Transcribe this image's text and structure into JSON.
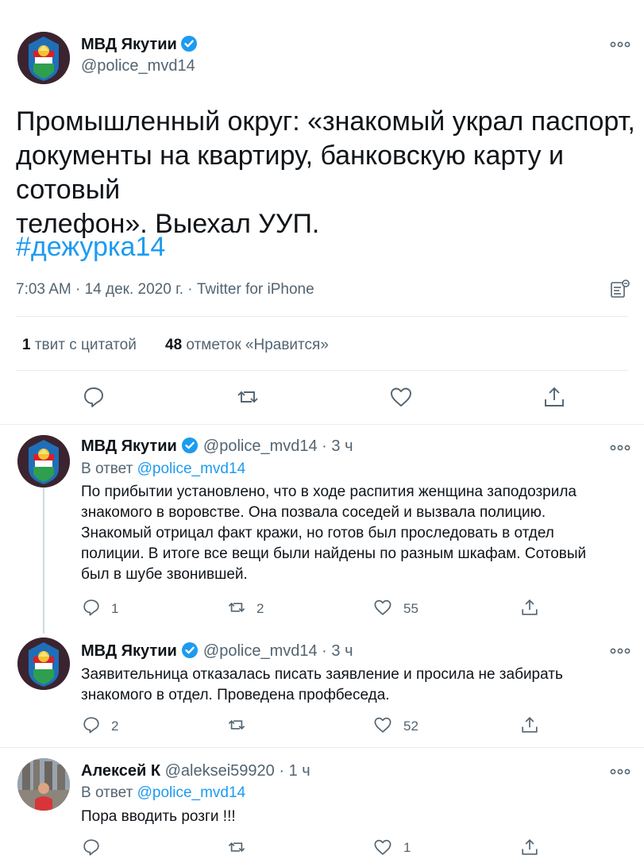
{
  "main_tweet": {
    "author_name": "МВД Якутии",
    "author_handle": "@police_mvd14",
    "text_lines": [
      "Промышленный округ: «знакомый украл паспорт,",
      "документы на квартиру, банковскую карту и сотовый",
      "телефон». Выехал УУП."
    ],
    "hashtag": "#дежурка14",
    "meta": "7:03 AM · 14 дек. 2020 г. · Twitter for iPhone",
    "quote_count": "1",
    "quote_label": "твит с цитатой",
    "like_count": "48",
    "like_label": "отметок «Нравится»"
  },
  "replies": [
    {
      "author_name": "МВД Якутии",
      "author_handle": "@police_mvd14 · 3 ч",
      "reply_to_prefix": "В ответ",
      "reply_to_mention": "@police_mvd14",
      "text_lines": [
        "По прибытии установлено, что в ходе распития женщина заподозрила",
        "знакомого в воровстве. Она позвала соседей и вызвала полицию.",
        "Знакомый отрицал факт кражи, но готов был проследовать в отдел",
        "полиции. В итоге все вещи были найдены по разным шкафам. Сотовый",
        "был в шубе звонившей."
      ],
      "reply_count": "1",
      "retweet_count": "2",
      "like_count": "55"
    },
    {
      "author_name": "МВД Якутии",
      "author_handle": "@police_mvd14 · 3 ч",
      "text_lines": [
        "Заявительница отказалась писать заявление и просила не забирать",
        "знакомого в отдел. Проведена профбеседа."
      ],
      "reply_count": "2",
      "retweet_count": "",
      "like_count": "52"
    },
    {
      "author_name": "Алексей К",
      "author_handle": "@aleksei59920 · 1 ч",
      "reply_to_prefix": "В ответ",
      "reply_to_mention": "@police_mvd14",
      "text_lines": [
        "Пора вводить розги !!!"
      ],
      "reply_count": "",
      "retweet_count": "",
      "like_count": "1"
    }
  ],
  "icons": {
    "more": "more-dots-icon",
    "verified": "verified-badge-icon",
    "reply": "reply-icon",
    "retweet": "retweet-icon",
    "like": "heart-icon",
    "share": "share-icon",
    "analytics": "analytics-icon"
  },
  "colors": {
    "accent": "#1d9bf0",
    "text": "#0f1419",
    "secondary": "#536471",
    "divider": "#e6ecf0"
  }
}
